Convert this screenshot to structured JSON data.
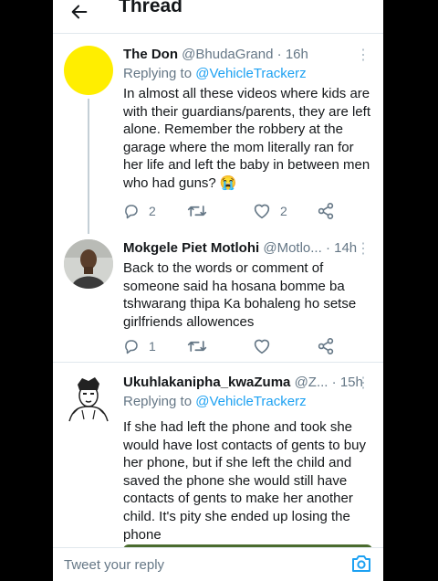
{
  "header": {
    "back_icon": "arrow-left-icon",
    "title": "Thread"
  },
  "tweets": [
    {
      "name": "The Don",
      "handle": "@BhudaGrand",
      "sep": "·",
      "time": "16h",
      "replying_prefix": "Replying to ",
      "replying_to": "@VehicleTrackerz",
      "text": "In almost all these videos where kids are with their guardians/parents, they are left alone. Remember the robbery at the garage where the mom literally ran for her life and left the baby in between men who had guns? 😭",
      "replies": "2",
      "retweets": "",
      "likes": "2",
      "avatar_color": "#ffee00"
    },
    {
      "name": "Mokgele Piet Motlohi",
      "handle": "@Motlo...",
      "sep": "·",
      "time": "14h",
      "text": "Back to the words or comment of someone said ha hosana bomme ba tshwarang thipa Ka bohaleng ho setse girlfriends allowences",
      "replies": "1",
      "retweets": "",
      "likes": ""
    },
    {
      "name": "Ukuhlakanipha_kwaZuma",
      "handle": "@Z...",
      "sep": "·",
      "time": "15h",
      "replying_prefix": "Replying to ",
      "replying_to": "@VehicleTrackerz",
      "text": "If she had left the phone and took she would have lost contacts of gents to buy her phone, but if she left the child and saved the phone she would still have contacts of gents to make her another child. It's pity she ended up losing the phone"
    }
  ],
  "compose": {
    "placeholder": "Tweet your reply",
    "camera_icon": "camera-icon"
  },
  "colors": {
    "link": "#1da1f2",
    "muted": "#657786",
    "border": "#e1e8ed"
  }
}
